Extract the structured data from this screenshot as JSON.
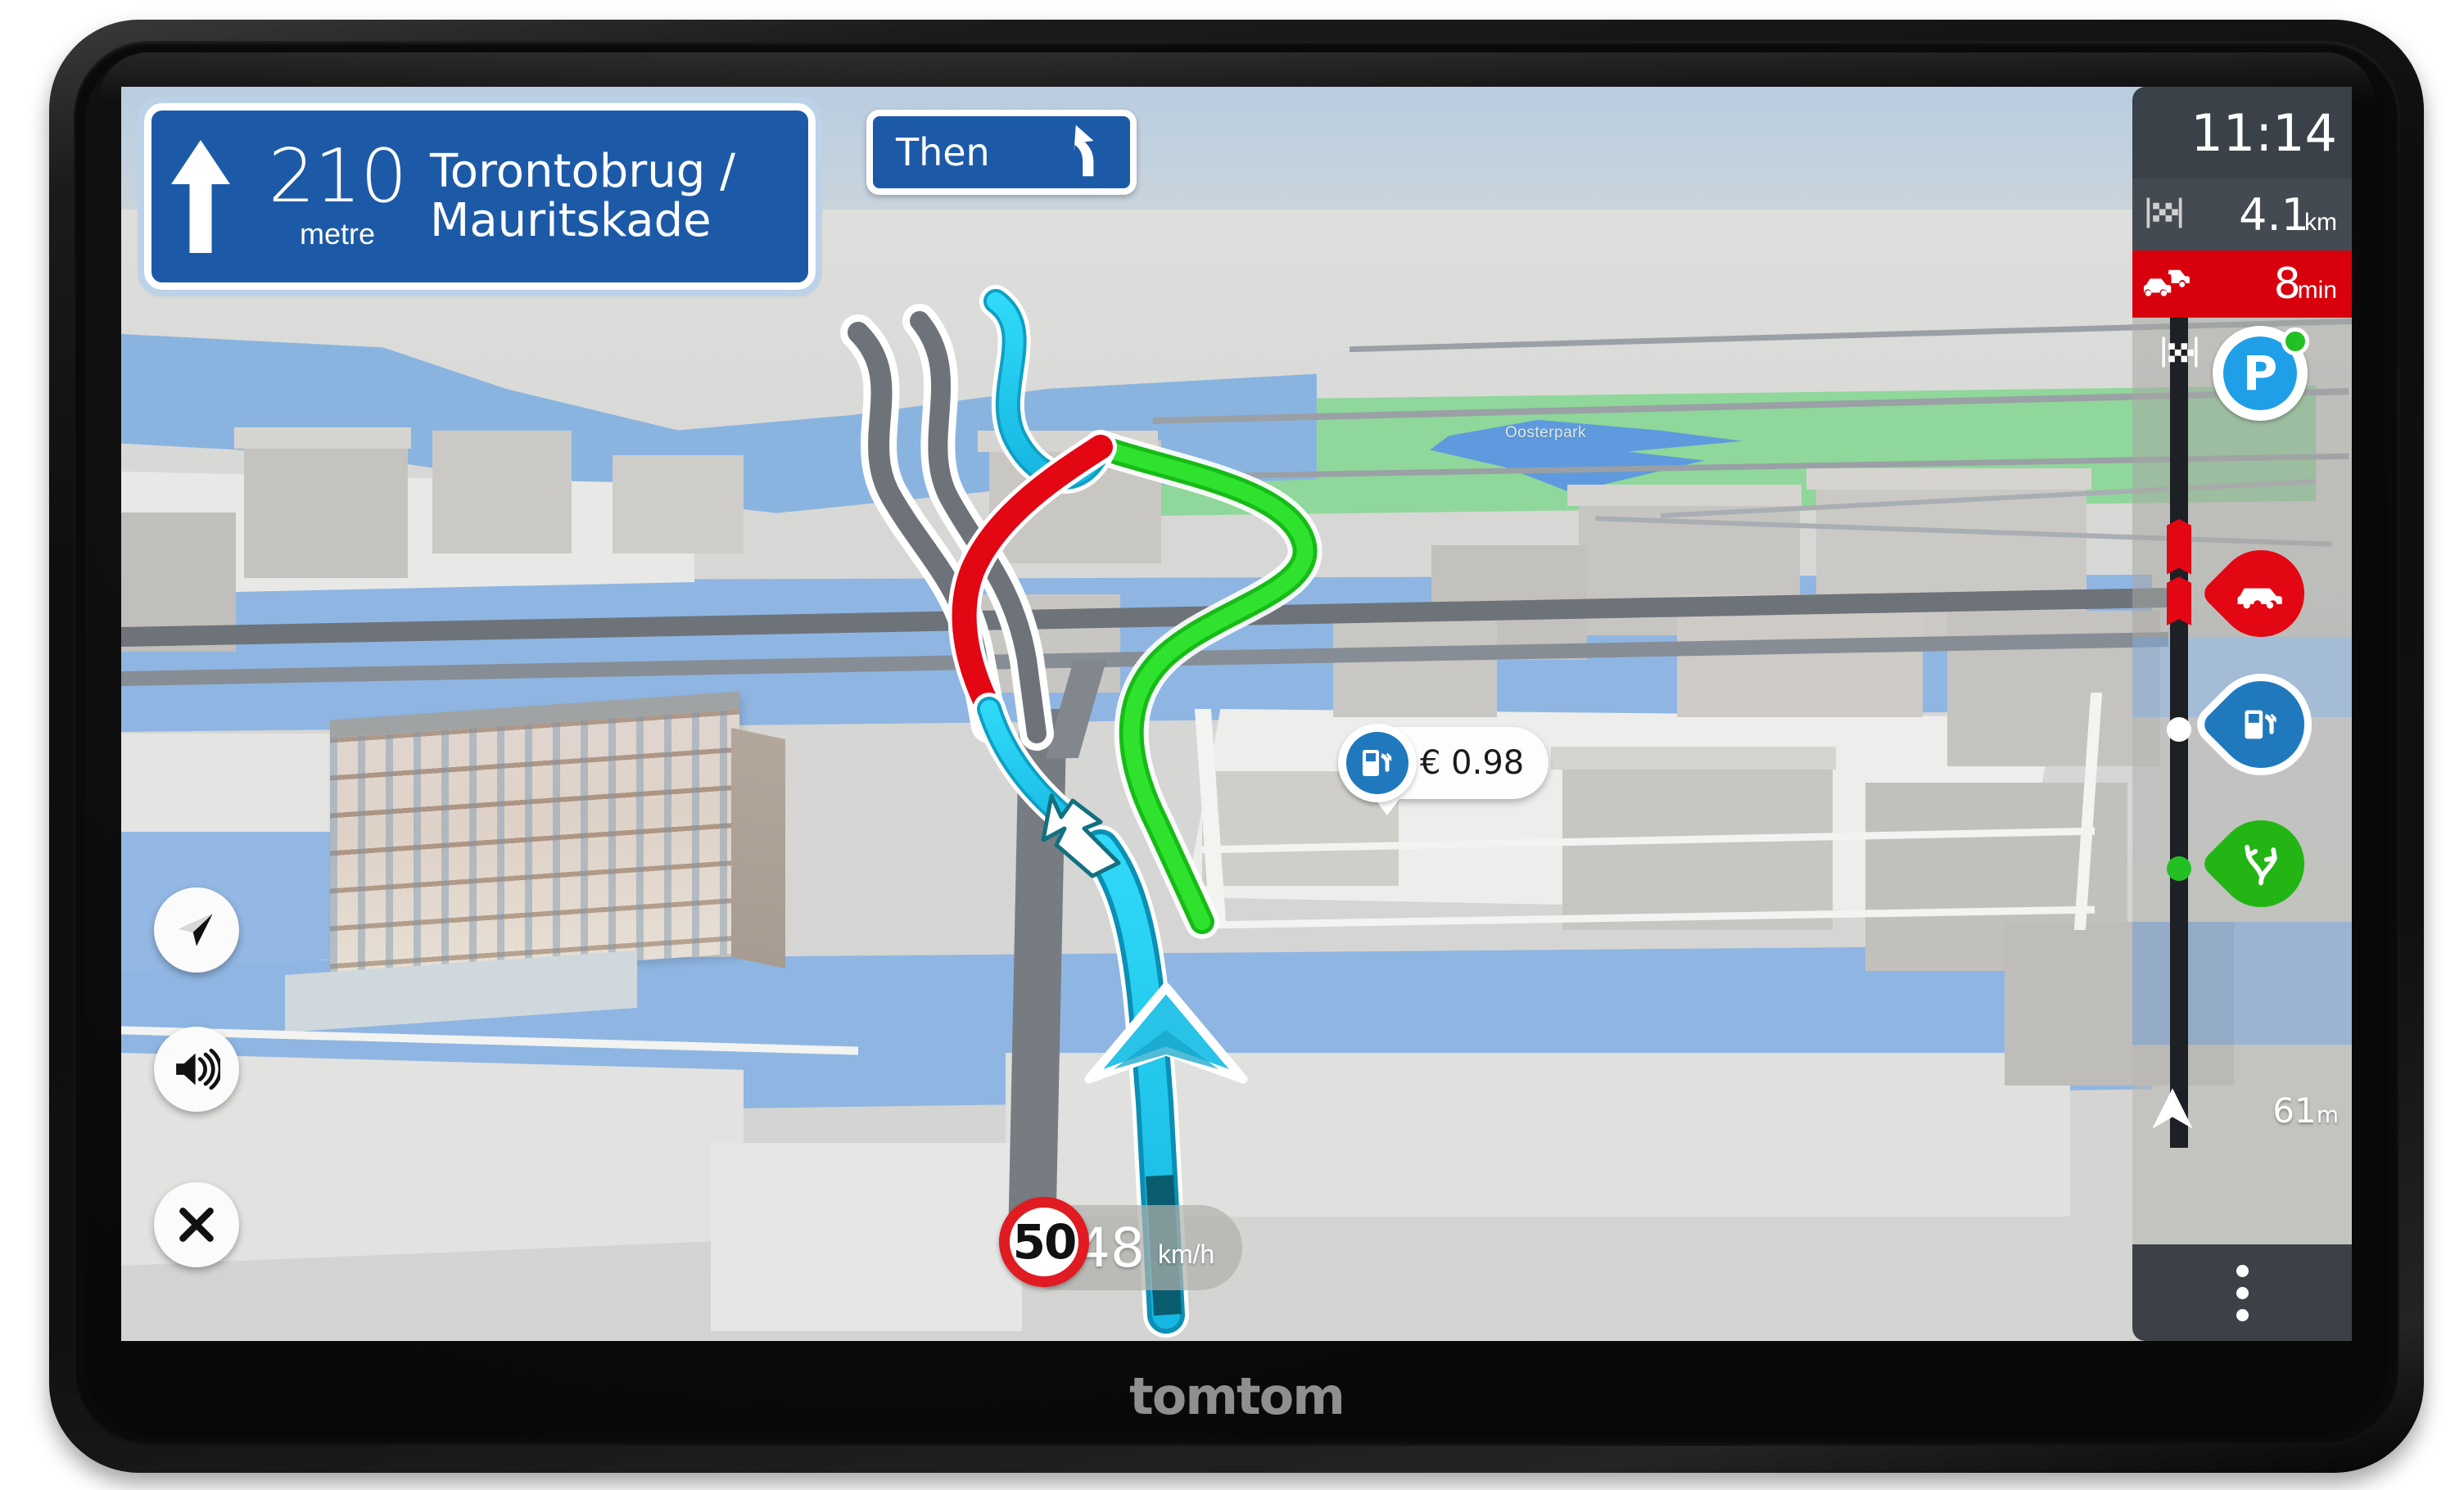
{
  "device": {
    "brand": "TomTom",
    "brand_upper": "TOMTOM"
  },
  "instruction": {
    "distance_value": "210",
    "distance_unit": "metre",
    "street_line1": "Torontobrug /",
    "street_line2": "Mauritskade",
    "maneuver_icon": "straight-arrow-icon"
  },
  "then_instruction": {
    "label": "Then",
    "maneuver_icon": "bear-left-arrow-icon"
  },
  "map_labels": {
    "park": "Oosterpark"
  },
  "poi_bubble": {
    "price": "€ 0.98",
    "icon": "fuel-pump-icon"
  },
  "speed": {
    "limit": "50",
    "current": "48",
    "unit": "km/h"
  },
  "sidebar": {
    "clock": "11:14",
    "remaining_distance": "4.1",
    "remaining_distance_unit": "km",
    "traffic_delay": "8",
    "traffic_delay_unit": "min",
    "destination_icon": "checkered-flag-icon",
    "current_position_distance": "61",
    "current_position_unit": "m",
    "menu_icon": "more-vertical-icon",
    "markers": [
      {
        "name": "parking",
        "icon": "parking-p-icon",
        "badge": "available-green-dot"
      },
      {
        "name": "traffic-jam",
        "icon": "car-icon"
      },
      {
        "name": "fuel-station",
        "icon": "fuel-pump-icon"
      },
      {
        "name": "alternative-route",
        "icon": "fork-arrows-icon"
      }
    ]
  },
  "map_buttons": {
    "compass": "compass-arrow-icon",
    "volume": "volume-on-icon",
    "close": "close-x-icon"
  },
  "colors": {
    "sign_blue": "#1c5aa8",
    "route_cyan": "#22c8f0",
    "route_alt_green": "#1ec81e",
    "traffic_red": "#e30613",
    "delay_bar_red": "#d8000c",
    "panel_dark": "#3a4149",
    "water_blue": "#8ab4e0",
    "park_green": "#8fd79a"
  }
}
